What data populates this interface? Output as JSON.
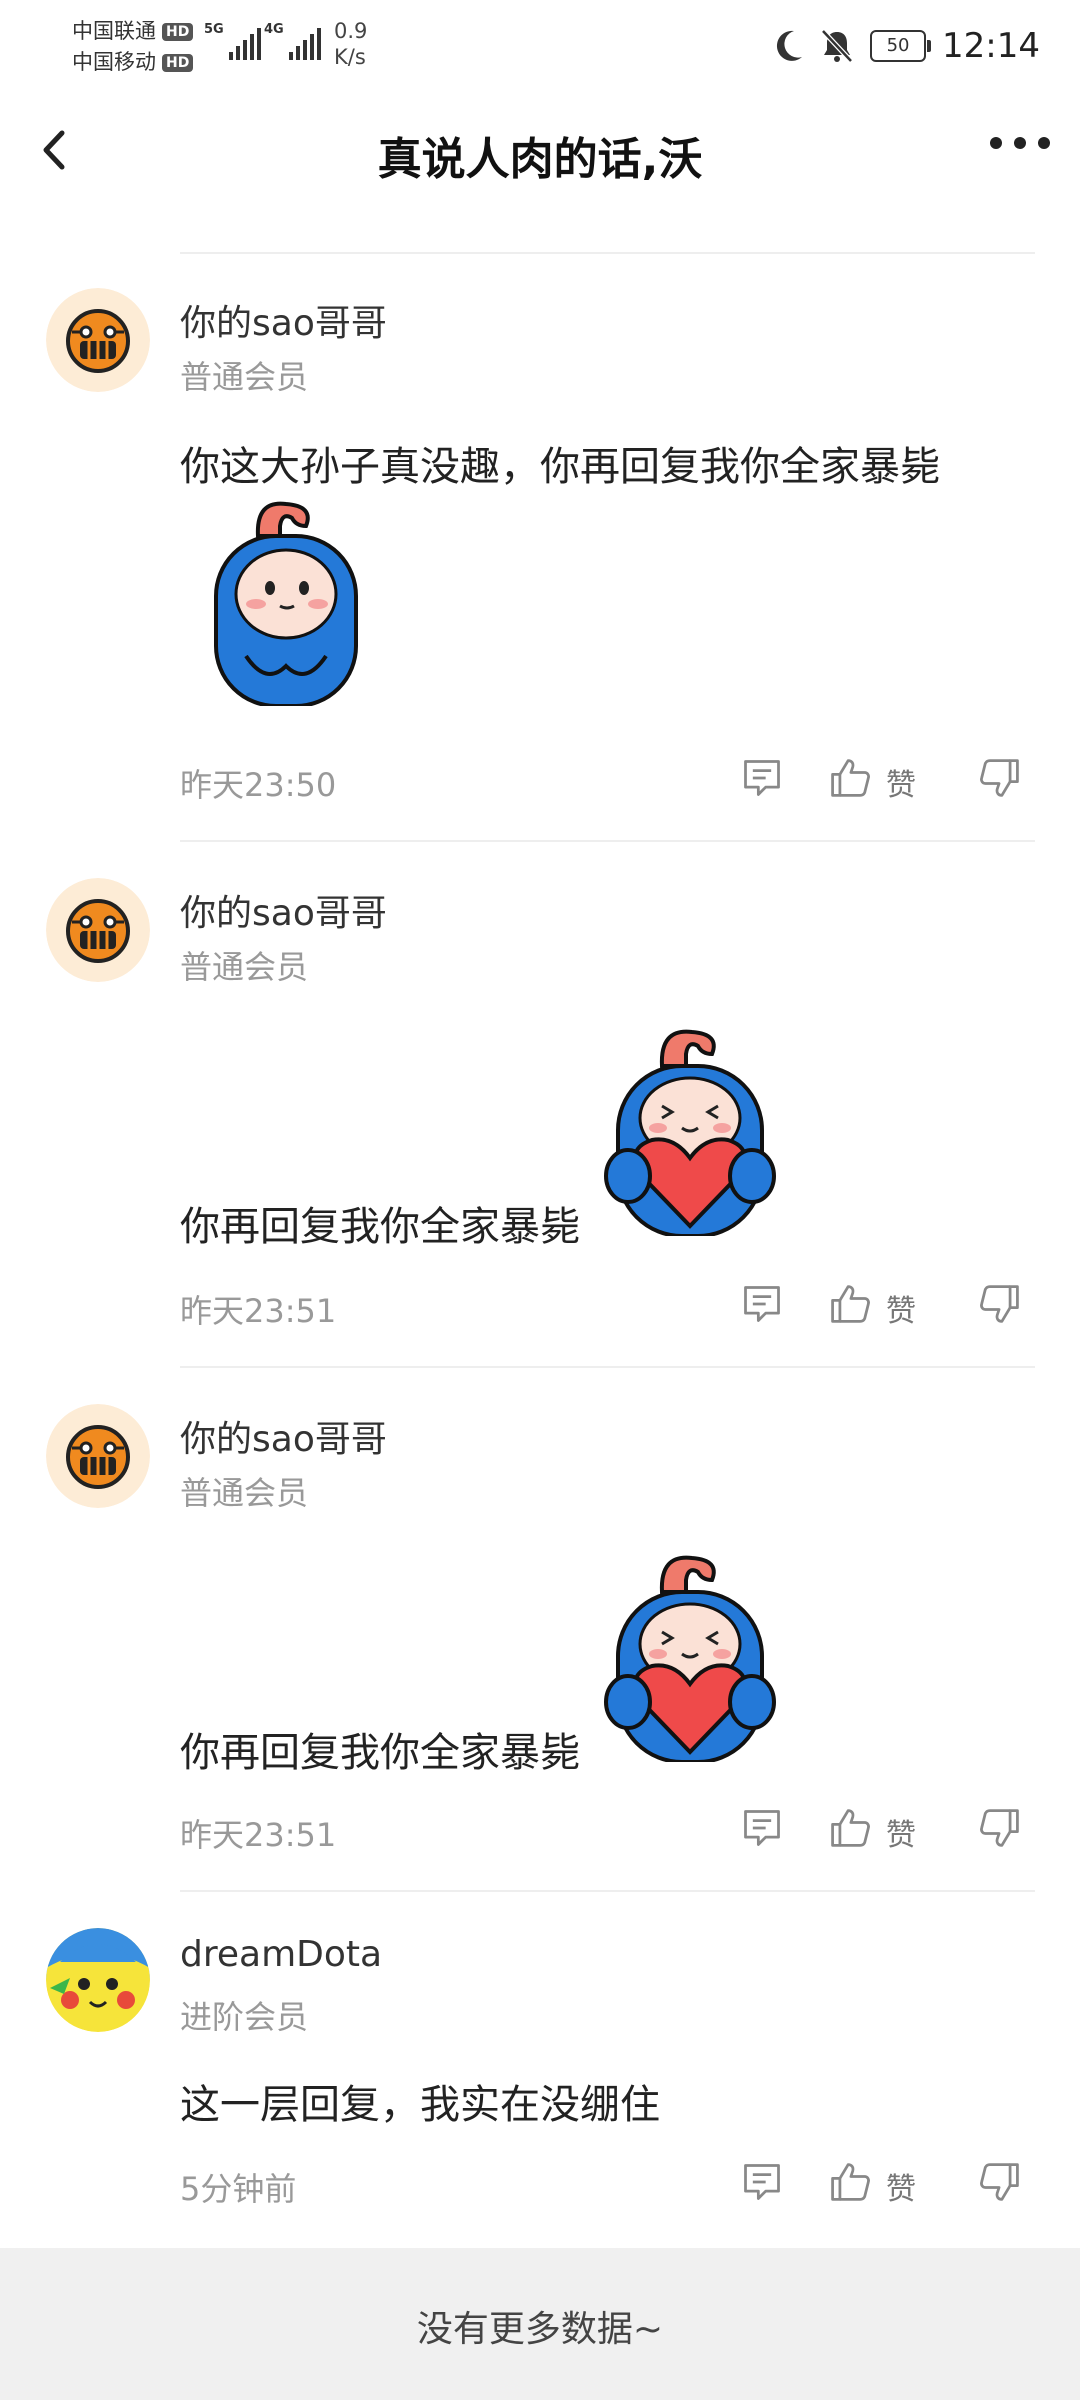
{
  "status_bar": {
    "carrier1": "中国联通",
    "carrier2": "中国移动",
    "hd": "HD",
    "net1": "5G",
    "net2": "4G",
    "speed_value": "0.9",
    "speed_unit": "K/s",
    "battery": "50",
    "time": "12:14"
  },
  "header": {
    "title": "真说人肉的话,沃"
  },
  "comments": [
    {
      "username": "你的sao哥哥",
      "level": "普通会员",
      "text": "你这大孙子真没趣，你再回复我你全家暴毙",
      "time": "昨天23:50",
      "like_label": "赞"
    },
    {
      "username": "你的sao哥哥",
      "level": "普通会员",
      "text": "你再回复我你全家暴毙",
      "time": "昨天23:51",
      "like_label": "赞"
    },
    {
      "username": "你的sao哥哥",
      "level": "普通会员",
      "text": "你再回复我你全家暴毙",
      "time": "昨天23:51",
      "like_label": "赞"
    },
    {
      "username": "dreamDota",
      "level": "进阶会员",
      "text": "这一层回复，我实在没绷住",
      "time": "5分钟前",
      "like_label": "赞"
    }
  ],
  "footer": {
    "text": "没有更多数据~"
  },
  "icons": {
    "back": "chevron-left-icon",
    "more": "more-horizontal-icon",
    "reply": "comment-icon",
    "like": "thumbs-up-icon",
    "dislike": "thumbs-down-icon",
    "moon": "moon-icon",
    "mute": "bell-off-icon"
  },
  "colors": {
    "avatar_bg": "#fdecd6",
    "avatar_face": "#f08a1f",
    "sticker_blue": "#2479d8",
    "sticker_pink": "#f3a49a"
  }
}
